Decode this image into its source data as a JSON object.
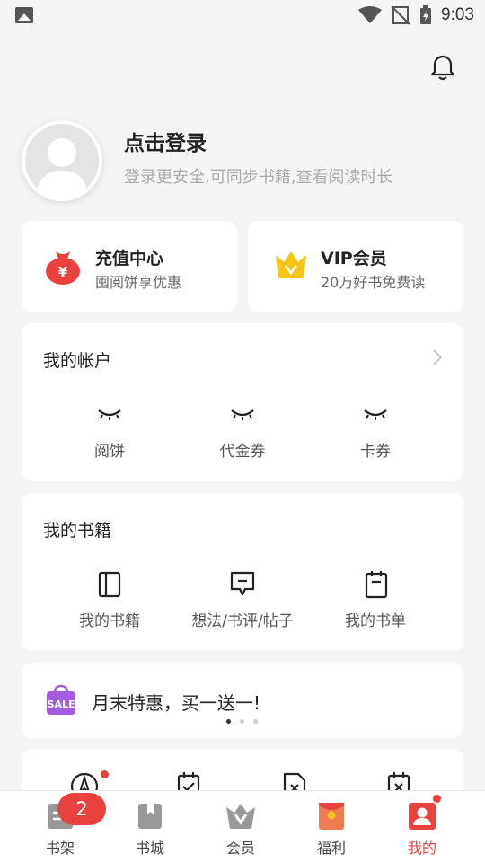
{
  "status_bar": {
    "time": "9:03"
  },
  "profile": {
    "title": "点击登录",
    "subtitle": "登录更安全,可同步书籍,查看阅读时长"
  },
  "promos": [
    {
      "title": "充值中心",
      "subtitle": "囤阅饼享优惠",
      "icon": "money-bag-icon"
    },
    {
      "title": "VIP会员",
      "subtitle": "20万好书免费读",
      "icon": "crown-icon"
    }
  ],
  "account": {
    "title": "我的帐户",
    "items": [
      {
        "label": "阅饼",
        "icon": "eye-closed-icon"
      },
      {
        "label": "代金券",
        "icon": "eye-closed-icon"
      },
      {
        "label": "卡券",
        "icon": "eye-closed-icon"
      }
    ]
  },
  "books": {
    "title": "我的书籍",
    "items": [
      {
        "label": "我的书籍",
        "icon": "book-icon"
      },
      {
        "label": "想法/书评/帖子",
        "icon": "comment-icon"
      },
      {
        "label": "我的书单",
        "icon": "booklist-icon"
      }
    ]
  },
  "banner": {
    "badge": "SALE",
    "text": "月末特惠，买一送一!",
    "pages": 3,
    "active_page": 1
  },
  "tabs": [
    {
      "label": "书架",
      "icon": "bookshelf-icon",
      "badge": "2"
    },
    {
      "label": "书城",
      "icon": "bookstore-icon"
    },
    {
      "label": "会员",
      "icon": "vip-icon"
    },
    {
      "label": "福利",
      "icon": "gift-icon"
    },
    {
      "label": "我的",
      "icon": "profile-icon",
      "active": true
    }
  ],
  "colors": {
    "accent": "#e8413e",
    "gold": "#f5c518"
  }
}
